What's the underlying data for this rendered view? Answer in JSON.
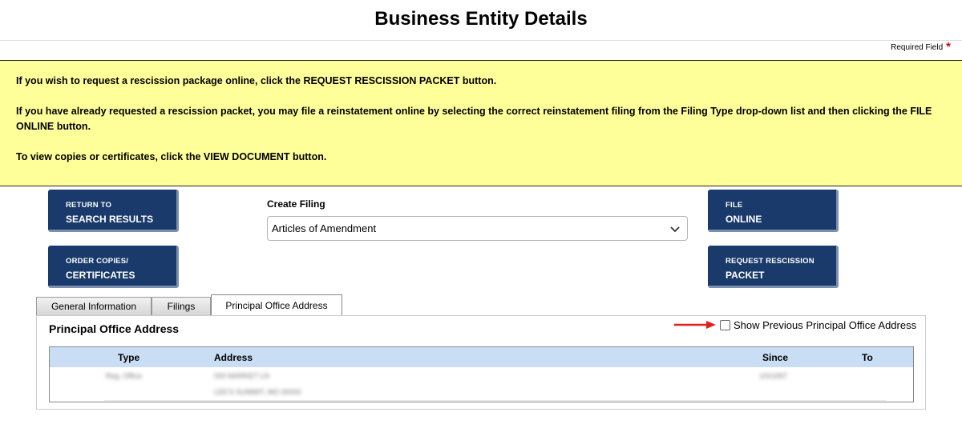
{
  "page": {
    "title": "Business Entity Details"
  },
  "required": {
    "label": "Required Field",
    "marker": "*",
    "marker_color": "#d0021b"
  },
  "notice": {
    "background": "#ffff99",
    "lines": [
      "If you wish to request a rescission package online, click the REQUEST RESCISSION PACKET button.",
      "If you have already requested a rescission packet, you may file a reinstatement online by selecting the correct reinstatement filing from the Filing Type drop-down list and then clicking the FILE ONLINE button.",
      "To view copies or certificates, click the VIEW DOCUMENT button."
    ]
  },
  "buttons": {
    "color": "#193a6a",
    "return": {
      "line1": "RETURN TO",
      "line2": "SEARCH RESULTS"
    },
    "order": {
      "line1": "ORDER COPIES/",
      "line2": "CERTIFICATES"
    },
    "file": {
      "line1": "FILE",
      "line2": "ONLINE"
    },
    "rescission": {
      "line1": "REQUEST RESCISSION",
      "line2": "PACKET"
    }
  },
  "filing": {
    "label": "Create Filing",
    "selected": "Articles of Amendment"
  },
  "tabs": [
    {
      "label": "General Information",
      "active": false
    },
    {
      "label": "Filings",
      "active": false
    },
    {
      "label": "Principal Office Address",
      "active": true
    }
  ],
  "panel": {
    "title": "Principal Office Address",
    "show_previous_label": "Show Previous Principal Office Address",
    "show_previous_checked": false,
    "arrow_color": "#e02020",
    "header_color": "#c9def4",
    "columns": [
      "Type",
      "Address",
      "Since",
      "To"
    ],
    "rows": [
      {
        "type": "Reg. Office",
        "address_line1": "000 MARKET LN",
        "address_line2": "LEE'S SUMMIT, MO 00000",
        "since": "1/0/1997",
        "to": ""
      }
    ]
  }
}
